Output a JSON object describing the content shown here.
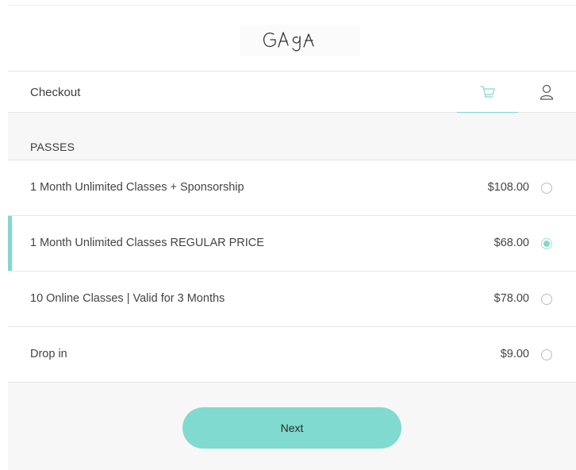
{
  "header": {
    "logo_text": "GAGA",
    "checkout_title": "Checkout",
    "cart_icon": "cart-icon",
    "user_icon": "user-icon",
    "active_tab": "cart"
  },
  "section": {
    "title": "PASSES"
  },
  "passes": [
    {
      "label": "1 Month Unlimited Classes + Sponsorship",
      "price": "$108.00",
      "selected": false
    },
    {
      "label": "1 Month Unlimited Classes REGULAR PRICE",
      "price": "$68.00",
      "selected": true
    },
    {
      "label": "10 Online Classes | Valid for 3 Months",
      "price": "$78.00",
      "selected": false
    },
    {
      "label": "Drop in",
      "price": "$9.00",
      "selected": false
    }
  ],
  "footer": {
    "next_label": "Next"
  },
  "colors": {
    "accent": "#7fd9cd",
    "background_grey": "#f7f7f7",
    "text": "#3a3a3a"
  }
}
